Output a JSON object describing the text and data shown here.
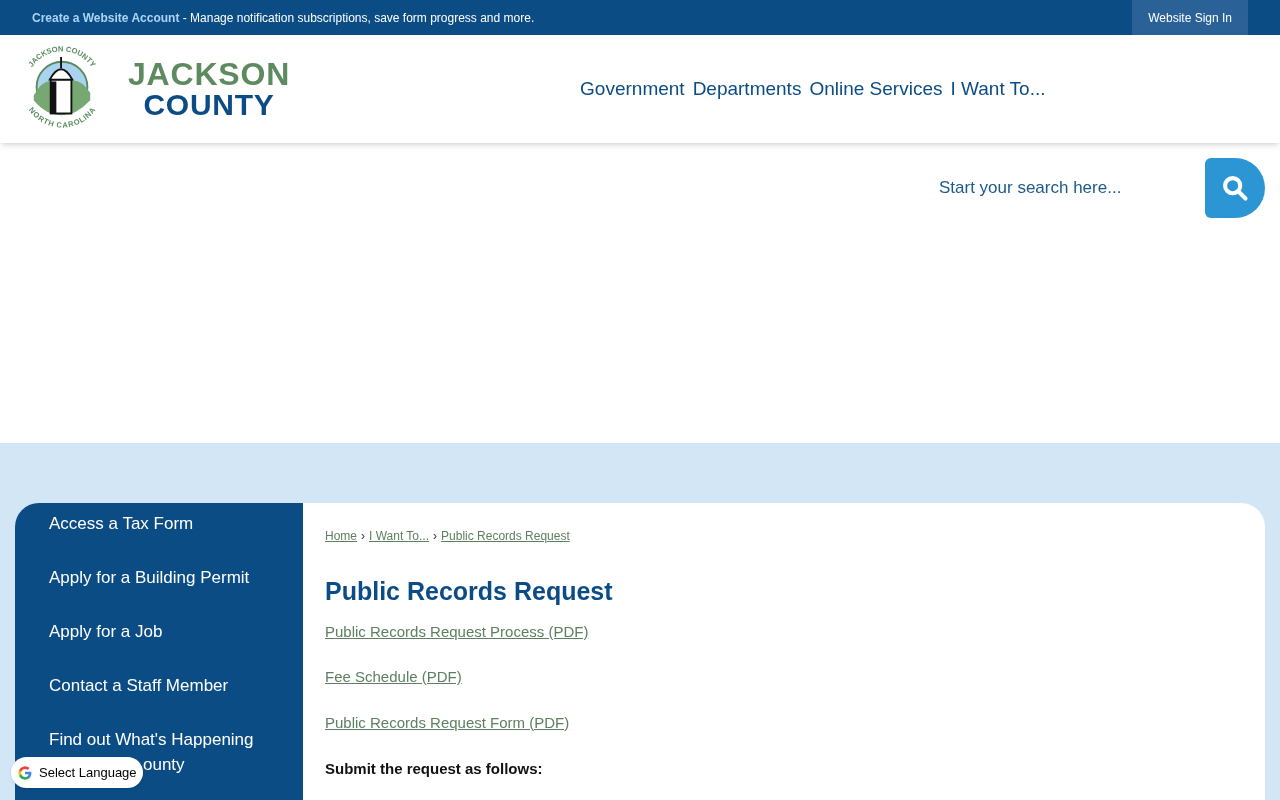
{
  "top_bar": {
    "account_link": "Create a Website Account",
    "account_text": "- Manage notification subscriptions, save form progress and more.",
    "sign_in": "Website Sign In"
  },
  "logo": {
    "seal_top": "JACKSON COUNTY",
    "seal_bottom": "NORTH CAROLINA",
    "name_line_1": "JACKSON",
    "name_line_2": "COUNTY"
  },
  "nav": [
    "Government",
    "Departments",
    "Online Services",
    "I Want To..."
  ],
  "search": {
    "placeholder": "Start your search here..."
  },
  "sidebar": {
    "items": [
      {
        "lines": [
          "Access a Tax Form"
        ]
      },
      {
        "lines": [
          "Apply for a Building Permit"
        ]
      },
      {
        "lines": [
          "Apply for a Job"
        ]
      },
      {
        "lines": [
          "Contact a Staff Member"
        ]
      },
      {
        "lines": [
          "Find out What's Happening",
          "ounty"
        ]
      }
    ]
  },
  "breadcrumb": [
    "Home",
    "I Want To...",
    "Public Records Request"
  ],
  "breadcrumb_separator": "›",
  "page_title": "Public Records Request",
  "links": [
    "Public Records Request Process (PDF)",
    "Fee Schedule (PDF)",
    "Public Records Request Form (PDF)"
  ],
  "instruction": "Submit the request as follows:",
  "language_widget": {
    "label": "Select Language"
  }
}
